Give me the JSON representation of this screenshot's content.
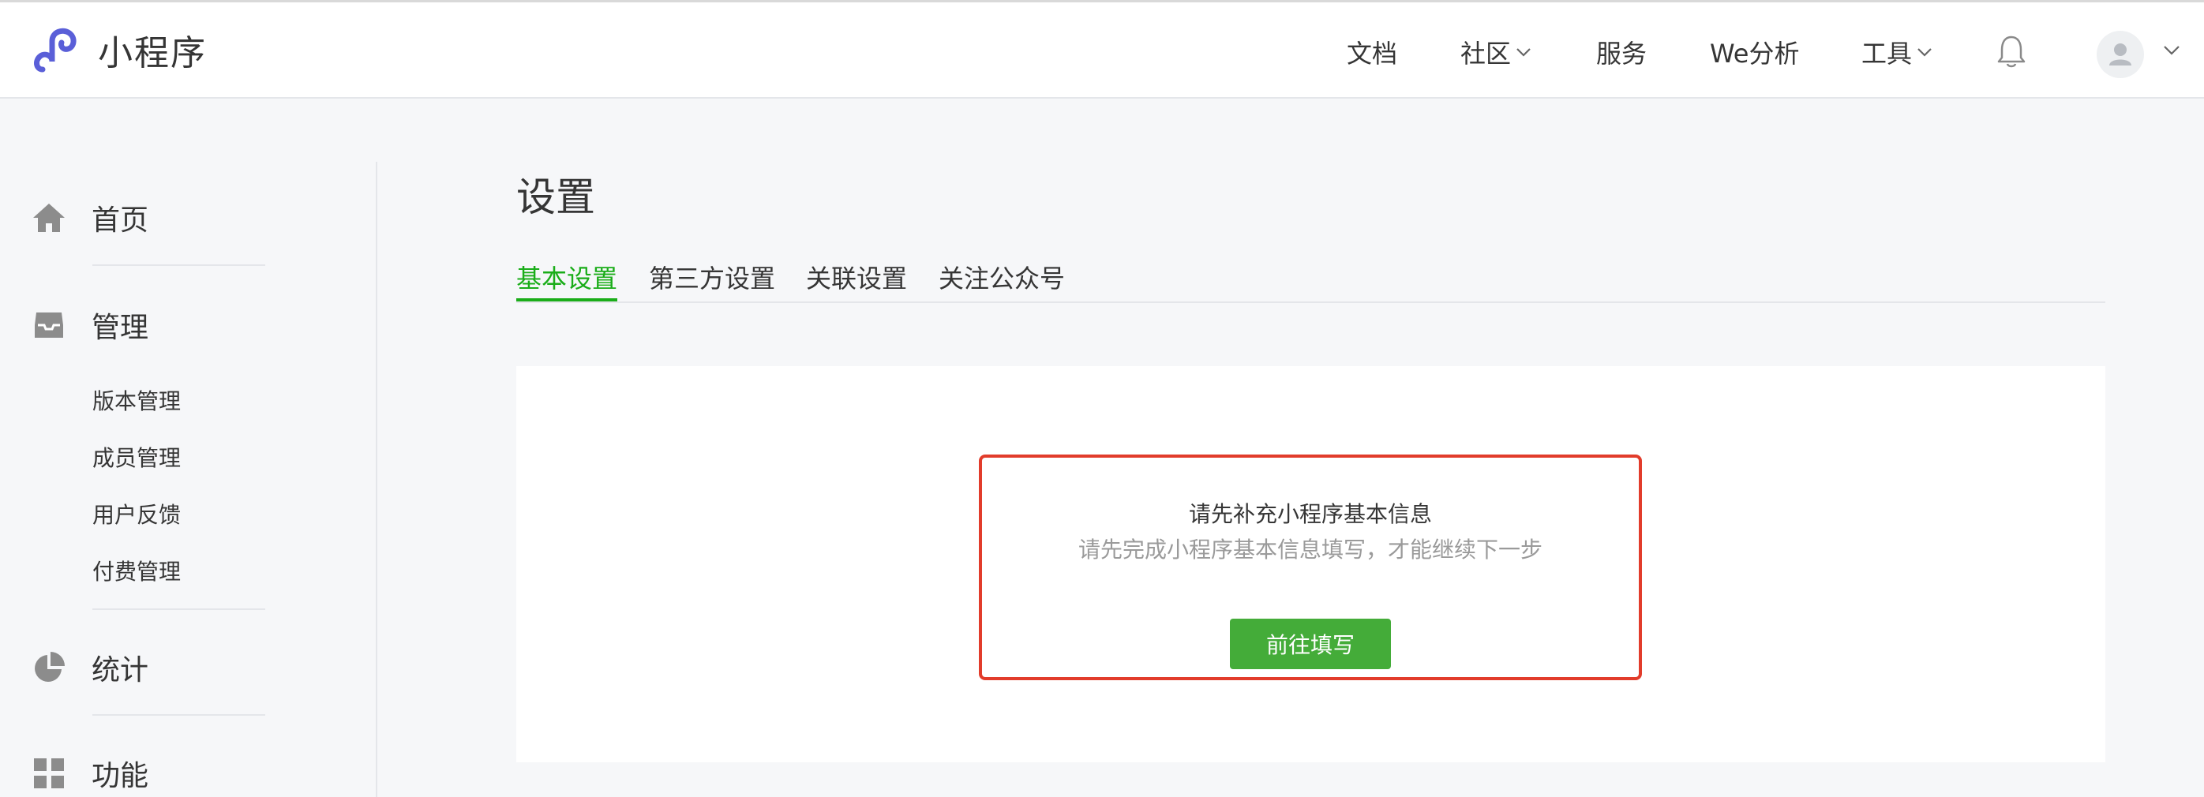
{
  "app": {
    "name": "小程序",
    "icon": "mini-program-logo-icon",
    "brand_color": "#5a5fd8"
  },
  "topnav": {
    "items": [
      {
        "label": "文档",
        "dropdown": false
      },
      {
        "label": "社区",
        "dropdown": true
      },
      {
        "label": "服务",
        "dropdown": false
      },
      {
        "label": "We分析",
        "dropdown": false
      },
      {
        "label": "工具",
        "dropdown": true
      }
    ],
    "notification_icon": "bell-icon",
    "avatar_icon": "user-avatar-icon"
  },
  "sidebar": {
    "sections": [
      {
        "label": "首页",
        "icon": "home-icon"
      },
      {
        "label": "管理",
        "icon": "inbox-icon",
        "children": [
          "版本管理",
          "成员管理",
          "用户反馈",
          "付费管理"
        ]
      },
      {
        "label": "统计",
        "icon": "pie-chart-icon"
      },
      {
        "label": "功能",
        "icon": "grid-icon"
      }
    ]
  },
  "main": {
    "title": "设置",
    "tabs": [
      {
        "label": "基本设置",
        "active": true
      },
      {
        "label": "第三方设置",
        "active": false
      },
      {
        "label": "关联设置",
        "active": false
      },
      {
        "label": "关注公众号",
        "active": false
      }
    ],
    "notice": {
      "title": "请先补充小程序基本信息",
      "subtitle": "请先完成小程序基本信息填写，才能继续下一步",
      "button_label": "前往填写",
      "highlight_color": "#e23c2b"
    }
  },
  "colors": {
    "accent": "#1aad19",
    "button": "#44ac39",
    "page_bg": "#f6f7f9"
  }
}
